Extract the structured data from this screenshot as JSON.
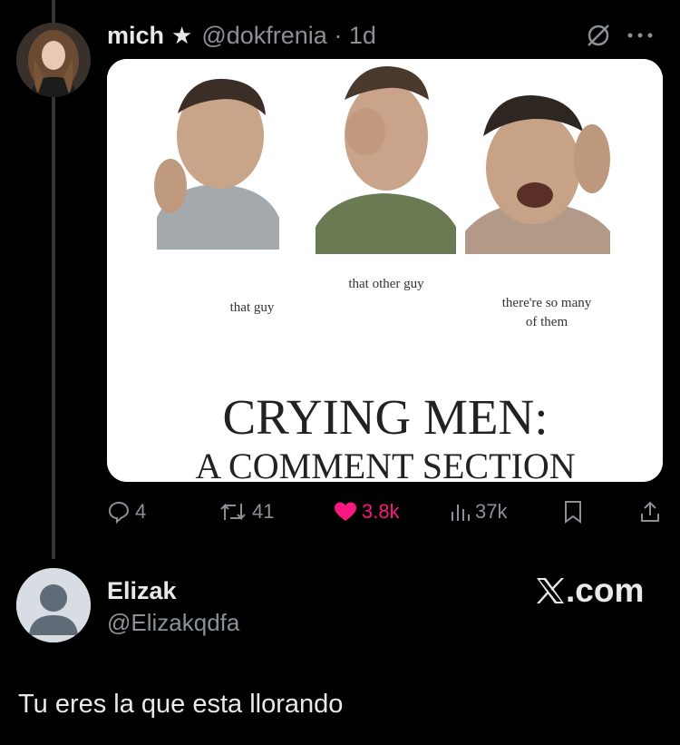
{
  "tweet": {
    "author_name": "mich",
    "author_badge_icon": "star-icon",
    "author_handle_time": "@dokfrenia · 1d",
    "media": {
      "captions": [
        "that guy",
        "that other guy",
        "there're so many",
        "of them"
      ],
      "title_line1": "CRYING MEN:",
      "title_line2": "A COMMENT SECTION"
    },
    "stats": {
      "replies": "4",
      "reposts": "41",
      "likes": "3.8k",
      "views": "37k"
    },
    "accent_color": "#f91880"
  },
  "reply": {
    "author_name": "Elizak",
    "author_handle": "@Elizakqdfa",
    "brand": ".com",
    "text": "Tu eres la que esta llorando"
  }
}
